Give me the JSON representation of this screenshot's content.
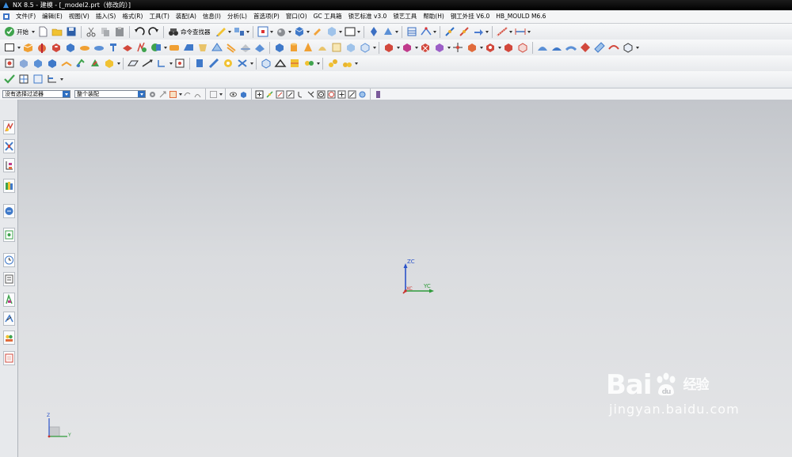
{
  "window": {
    "title": "NX 8.5 - 建模 - [_model2.prt（修改的）]"
  },
  "menubar": {
    "items": [
      "文件(F)",
      "编辑(E)",
      "视图(V)",
      "插入(S)",
      "格式(R)",
      "工具(T)",
      "装配(A)",
      "信息(I)",
      "分析(L)",
      "首选项(P)",
      "窗口(O)",
      "GC 工具箱",
      "锁艺标准 v3.0",
      "锁艺工具",
      "帮助(H)",
      "钢工外挂 V6.0",
      "HB_MOULD M6.6"
    ]
  },
  "toolbar": {
    "start_label": "开始",
    "command_finder_label": "命令查找器"
  },
  "filterbar": {
    "type_filter": "没有选择过滤器",
    "scope_filter": "整个装配"
  },
  "viewport": {
    "triad": {
      "z_label": "ZC",
      "y_label": "YC",
      "x_label": "XC"
    },
    "mini_triad": {
      "z_label": "Z",
      "y_label": "Y"
    }
  },
  "watermark": {
    "brand": "Bai",
    "brand2": "du",
    "suffix": "经验",
    "url": "jingyan.baidu.com"
  },
  "colors": {
    "titlebar": "#000000",
    "accent": "#2f6fc1",
    "viewport_top": "#c3c6cb",
    "viewport_bottom": "#e4e5e7"
  }
}
